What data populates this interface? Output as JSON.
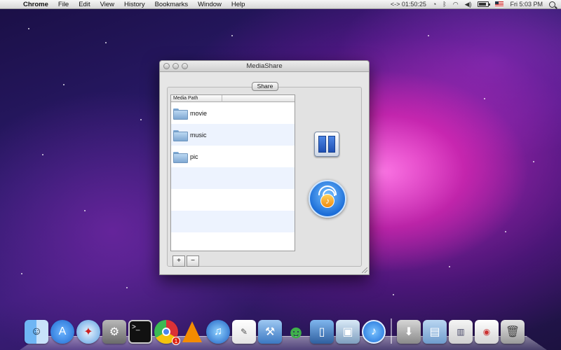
{
  "menubar": {
    "app_name": "Chrome",
    "menus": [
      "File",
      "Edit",
      "View",
      "History",
      "Bookmarks",
      "Window",
      "Help"
    ],
    "timer": "<-> 01:50:25",
    "clock": "Fri 5:03 PM"
  },
  "window": {
    "title": "MediaShare",
    "tab_label": "Share",
    "table_header": "Media Path",
    "rows": [
      "movie",
      "music",
      "pic"
    ],
    "add_label": "+",
    "remove_label": "−"
  },
  "dock": {
    "chrome_badge": "1",
    "icons": [
      "finder-icon",
      "app-store-icon",
      "safari-icon",
      "system-preferences-icon",
      "terminal-icon",
      "chrome-icon",
      "vlc-icon",
      "itunes-icon",
      "textedit-icon",
      "xcode-icon",
      "messenger-icon",
      "ios-simulator-icon",
      "preview-icon",
      "mediashare-icon",
      "downloads-icon",
      "applications-folder-icon",
      "documents-stack-icon",
      "web-stack-icon",
      "trash-icon"
    ]
  }
}
